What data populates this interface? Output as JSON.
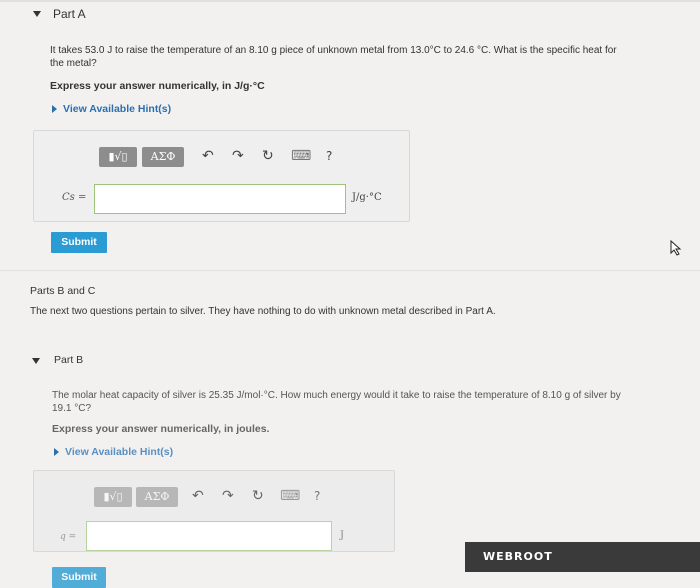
{
  "part_a": {
    "title": "Part A",
    "question_line1": "It takes 53.0 J to raise the temperature of an 8.10 g piece of unknown metal from 13.0°C to 24.6 °C. What is the specific heat for",
    "question_line2": "the metal?",
    "instruction": "Express your answer numerically, in J/g·°C",
    "hints_label": "View Available Hint(s)",
    "toolbar": {
      "templates": "▮√▯",
      "symbols": "ΑΣΦ",
      "undo": "↶",
      "redo": "↷",
      "reset": "↻",
      "keyboard": "⌨",
      "help": "?"
    },
    "answer_label": "Cs =",
    "answer_value": "",
    "answer_unit": "J/g·°C",
    "submit_label": "Submit"
  },
  "parts_bc": {
    "heading": "Parts B and C",
    "description": "The next two questions pertain to silver. They have nothing to do with unknown metal described in Part A."
  },
  "part_b": {
    "title": "Part B",
    "question_line1": "The molar heat capacity of silver is 25.35 J/mol·°C. How much energy would it take to raise the temperature of 8.10 g of silver by",
    "question_line2": "19.1 °C?",
    "instruction": "Express your answer numerically, in joules.",
    "hints_label": "View Available Hint(s)",
    "toolbar": {
      "templates": "▮√▯",
      "symbols": "ΑΣΦ",
      "undo": "↶",
      "redo": "↷",
      "reset": "↻",
      "keyboard": "⌨",
      "help": "?"
    },
    "answer_label": "q =",
    "answer_value": "",
    "answer_unit": "J",
    "submit_label": "Submit"
  },
  "overlay": {
    "brand": "WEBROOT"
  },
  "colors": {
    "accent": "#2c6fb0",
    "submit": "#2b9bd3",
    "input_border": "#9ec37e"
  }
}
